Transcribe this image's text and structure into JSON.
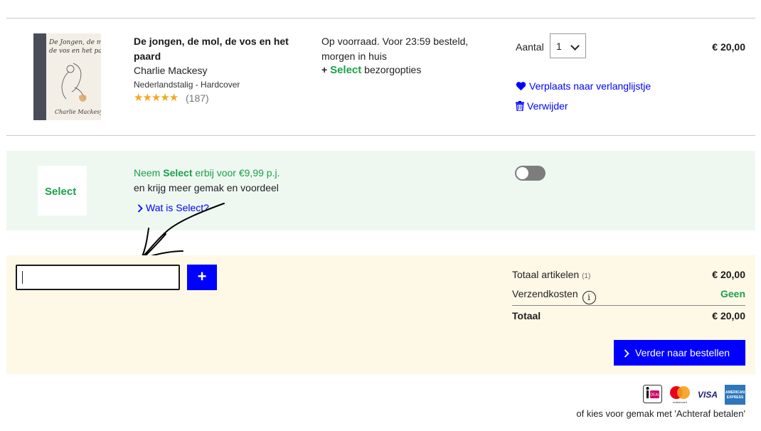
{
  "product": {
    "cover_title_line1": "De Jongen, de mol,",
    "cover_title_line2": "de vos en het paard",
    "cover_author": "Charlie Mackesy",
    "title": "De jongen, de mol, de vos en het paard",
    "author": "Charlie Mackesy",
    "meta": "Nederlandstalig - Hardcover",
    "stars": "★★★★★",
    "rating_value": 5,
    "reviews": "(187)",
    "stock": "Op voorraad. Voor 23:59 besteld, morgen in huis",
    "select_plus": "+",
    "select_label": "Select",
    "select_suffix": "bezorgopties",
    "quantity_label": "Aantal",
    "quantity_value": "1",
    "price": "€ 20,00",
    "wishlist_link": "Verplaats naar verlanglijstje",
    "remove_link": "Verwijder"
  },
  "promo": {
    "logo": "Select",
    "line1_prefix": "Neem",
    "line1_brand": "Select",
    "line1_suffix": "erbij voor €9,99 p.j.",
    "line2": "en krijg meer gemak en voordeel",
    "link": "Wat is Select?",
    "toggle_on": false
  },
  "coupon": {
    "value": "",
    "add_label": "+"
  },
  "totals": {
    "items_label": "Totaal artikelen",
    "items_count": "(1)",
    "items_value": "€ 20,00",
    "shipping_label": "Verzendkosten",
    "shipping_info": "i",
    "shipping_value": "Geen",
    "total_label": "Totaal",
    "total_value": "€ 20,00",
    "order_button": "Verder naar bestellen"
  },
  "payment": {
    "ideal": "iDEAL",
    "mastercard": "mastercard",
    "visa": "VISA",
    "amex_line1": "AMERICAN",
    "amex_line2": "EXPRESS",
    "footer": "of kies voor gemak met 'Achteraf betalen'"
  },
  "colors": {
    "accent": "#0000ff",
    "green": "#1ba04a",
    "panel": "#fef8e7",
    "promo_bg": "#eef8f1"
  }
}
